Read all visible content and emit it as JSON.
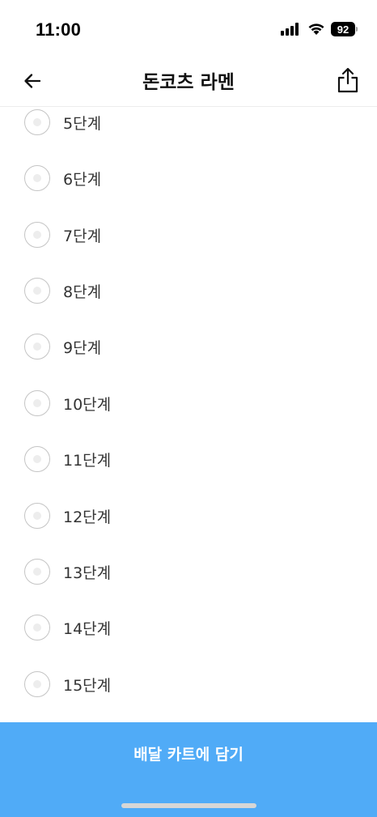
{
  "status_bar": {
    "time": "11:00",
    "battery": "92",
    "icons": [
      "signal-icon",
      "wifi-icon",
      "battery-icon"
    ]
  },
  "nav": {
    "title": "돈코츠 라멘",
    "back_icon": "arrow-left-icon",
    "share_icon": "share-icon"
  },
  "options": {
    "items": [
      {
        "label": "5단계",
        "selected": false
      },
      {
        "label": "6단계",
        "selected": false
      },
      {
        "label": "7단계",
        "selected": false
      },
      {
        "label": "8단계",
        "selected": false
      },
      {
        "label": "9단계",
        "selected": false
      },
      {
        "label": "10단계",
        "selected": false
      },
      {
        "label": "11단계",
        "selected": false
      },
      {
        "label": "12단계",
        "selected": false
      },
      {
        "label": "13단계",
        "selected": false
      },
      {
        "label": "14단계",
        "selected": false
      },
      {
        "label": "15단계",
        "selected": false
      }
    ]
  },
  "cta": {
    "label": "배달 카트에 담기",
    "color": "#50abf7"
  }
}
